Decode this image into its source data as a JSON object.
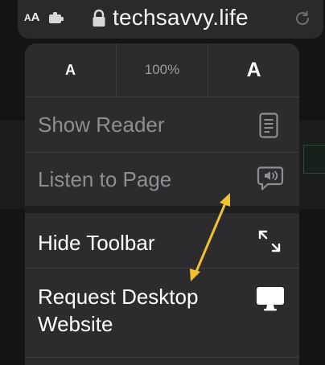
{
  "address_bar": {
    "text_size_label_small": "A",
    "text_size_label_large": "A",
    "domain": "techsavvy.life"
  },
  "menu": {
    "zoom": {
      "decrease_label": "A",
      "level": "100%",
      "increase_label": "A"
    },
    "items": [
      {
        "label": "Show Reader",
        "icon": "reader-icon",
        "enabled": false
      },
      {
        "label": "Listen to Page",
        "icon": "speech-bubble-icon",
        "enabled": false
      },
      {
        "label": "Hide Toolbar",
        "icon": "expand-arrows-icon",
        "enabled": true
      },
      {
        "label": "Request Desktop Website",
        "icon": "desktop-icon",
        "enabled": true
      }
    ]
  },
  "colors": {
    "annotation_arrow": "#f2c22e",
    "menu_background": "#2c2c2e",
    "disabled_text": "#8e8e93"
  }
}
